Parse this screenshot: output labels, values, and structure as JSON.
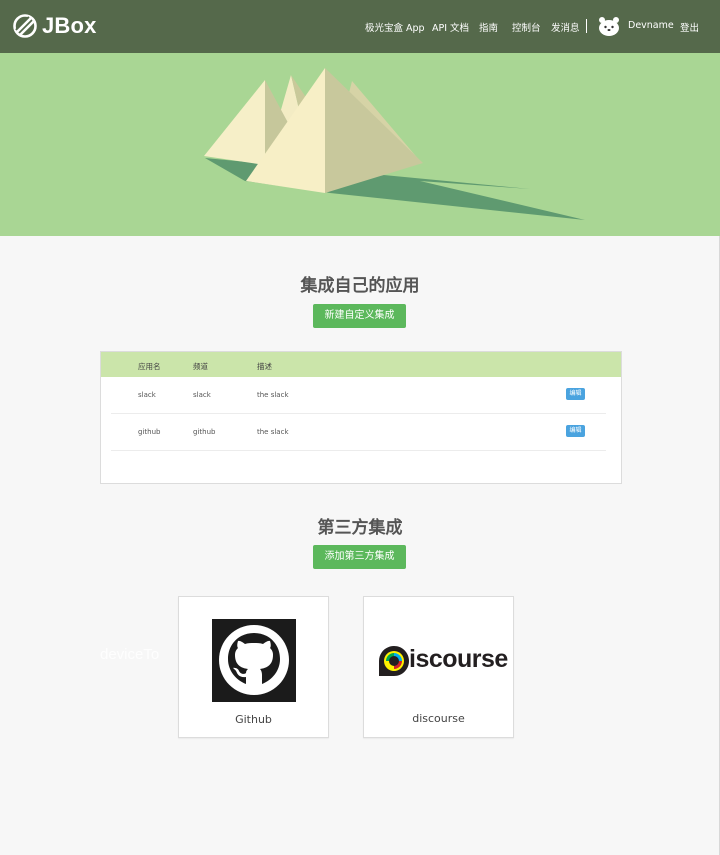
{
  "header": {
    "brand": "JBox",
    "nav": [
      {
        "label": "极光宝盒 App"
      },
      {
        "label": "API 文档"
      },
      {
        "label": "指南"
      },
      {
        "label": "控制台"
      },
      {
        "label": "发消息"
      }
    ],
    "username": "Devname",
    "logout": "登出"
  },
  "custom_section": {
    "title": "集成自己的应用",
    "button": "新建自定义集成",
    "columns": [
      "应用名",
      "频道",
      "描述"
    ],
    "rows": [
      {
        "name": "slack",
        "channel": "slack",
        "desc": "the slack",
        "action": "编辑"
      },
      {
        "name": "github",
        "channel": "github",
        "desc": "the slack",
        "action": "编辑"
      }
    ]
  },
  "third_party_section": {
    "title": "第三方集成",
    "button": "添加第三方集成",
    "integrations": [
      {
        "name": "Github"
      },
      {
        "name": "discourse",
        "logo_text": "iscourse"
      }
    ]
  },
  "watermark": "deviceTo",
  "colors": {
    "header_bg": "#55694b",
    "hero_bg": "#a9d694",
    "primary_green": "#5cb85c",
    "table_header": "#cbe5aa",
    "edit_blue": "#4aa3df"
  }
}
